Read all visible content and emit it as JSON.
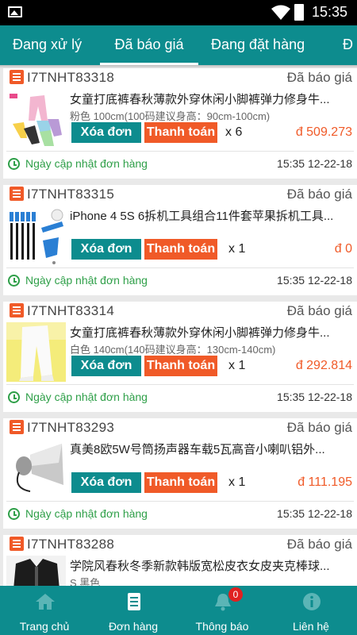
{
  "status_bar": {
    "time": "15:35"
  },
  "tabs": [
    "Đang xử lý",
    "Đã báo giá",
    "Đang đặt hàng",
    "Đ"
  ],
  "active_tab": "Đã báo giá",
  "labels": {
    "delete": "Xóa đơn",
    "pay": "Thanh toán",
    "updated": "Ngày cập nhật đơn hàng"
  },
  "orders": [
    {
      "code": "I7TNHT83318",
      "status": "Đã báo giá",
      "title": "女童打底裤春秋薄款外穿休闲小脚裤弹力修身牛...",
      "variant": "粉色 100cm(100码建议身高：90cm-100cm)",
      "qty": "x 6",
      "price": "đ 509.273",
      "date": "15:35 12-22-18",
      "thumb": "leggings-colors"
    },
    {
      "code": "I7TNHT83315",
      "status": "Đã báo giá",
      "title": "iPhone 4 5S 6拆机工具组合11件套苹果拆机工具...",
      "variant": "",
      "qty": "x 1",
      "price": "đ 0",
      "date": "15:35 12-22-18",
      "thumb": "tool-kit"
    },
    {
      "code": "I7TNHT83314",
      "status": "Đã báo giá",
      "title": "女童打底裤春秋薄款外穿休闲小脚裤弹力修身牛...",
      "variant": "白色  140cm(140码建议身高：130cm-140cm)",
      "qty": "x 1",
      "price": "đ 292.814",
      "date": "15:35 12-22-18",
      "thumb": "white-leggings"
    },
    {
      "code": "I7TNHT83293",
      "status": "Đã báo giá",
      "title": "真美8欧5W号筒扬声器车载5瓦高音小喇叭铝外...",
      "variant": "",
      "qty": "x 1",
      "price": "đ 111.195",
      "date": "15:35 12-22-18",
      "thumb": "horn-speaker"
    },
    {
      "code": "I7TNHT83288",
      "status": "Đã báo giá",
      "title": "学院风春秋冬季新款韩版宽松皮衣女皮夹克棒球...",
      "variant": "S 黑色",
      "qty": "",
      "price": "",
      "date": "",
      "thumb": "leather-jacket"
    }
  ],
  "bottom_nav": [
    {
      "label": "Trang chủ",
      "icon": "home-icon"
    },
    {
      "label": "Đơn hàng",
      "icon": "orders-icon"
    },
    {
      "label": "Thông báo",
      "icon": "bell-icon",
      "badge": "0"
    },
    {
      "label": "Liên hệ",
      "icon": "info-icon"
    }
  ],
  "colors": {
    "teal": "#0d8c8e",
    "orange": "#f05a28",
    "green": "#2e9f48"
  }
}
